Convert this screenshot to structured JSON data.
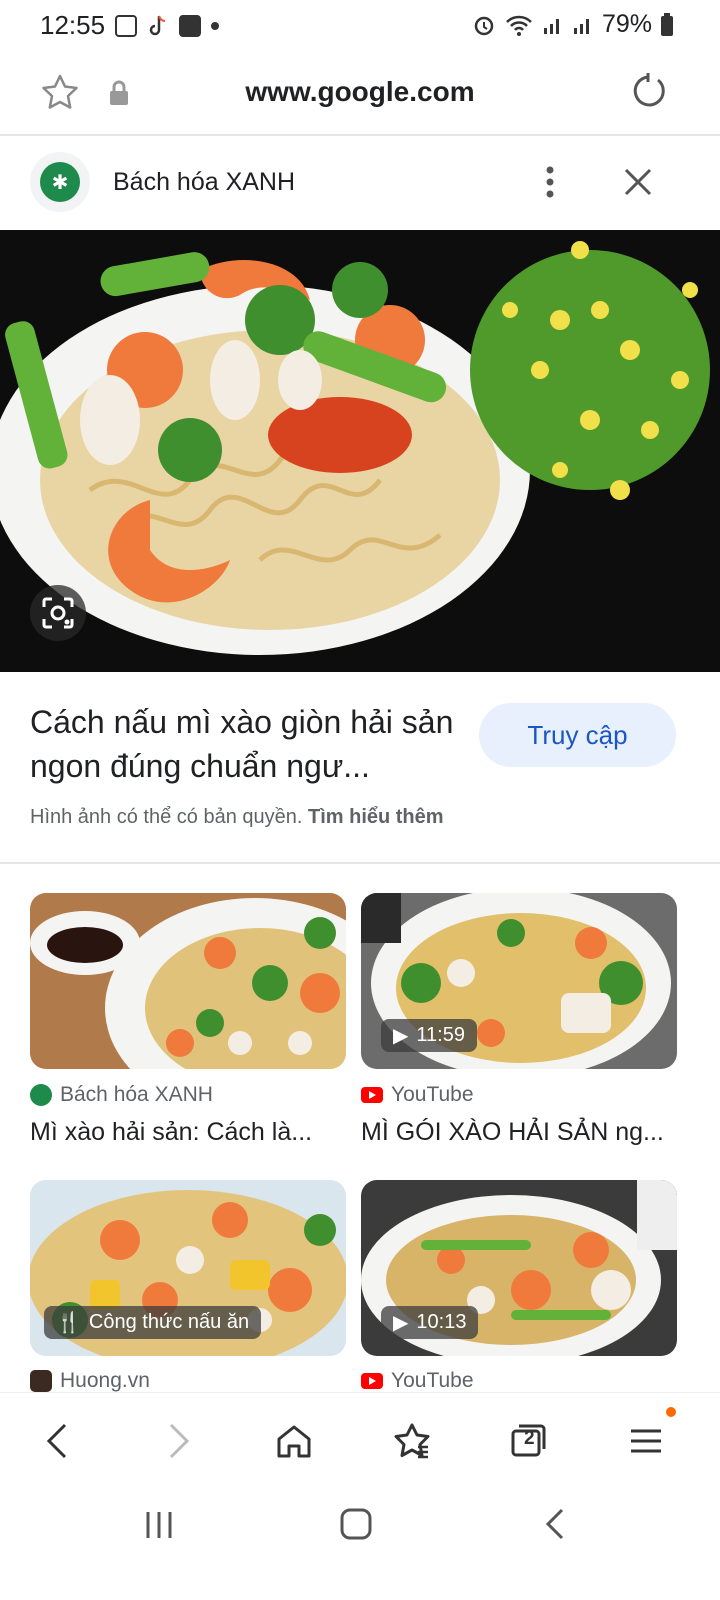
{
  "status": {
    "time": "12:55",
    "battery": "79%"
  },
  "browser": {
    "url": "www.google.com"
  },
  "site": {
    "name": "Bách hóa XANH"
  },
  "result": {
    "title": "Cách nấu mì xào giòn hải sản ngon đúng chuẩn ngư...",
    "visit_label": "Truy cập",
    "copyright_text": "Hình ảnh có thể có bản quyền.",
    "learn_more": "Tìm hiểu thêm"
  },
  "cards": [
    {
      "source": "Bách hóa XANH",
      "title": "Mì xào hải sản: Cách là...",
      "badge": ""
    },
    {
      "source": "YouTube",
      "title": "MÌ GÓI XÀO HẢI SẢN ng...",
      "badge": "11:59"
    },
    {
      "source": "Huong.vn",
      "title": "",
      "badge": "Công thức nấu ăn"
    },
    {
      "source": "YouTube",
      "title": "",
      "badge": "10:13"
    }
  ],
  "bottom_nav": {
    "tabs_count": "2"
  },
  "colors": {
    "accent": "#1a56c4",
    "visit_bg": "#e8f0fe",
    "brand_green": "#1e8a4c",
    "notification_dot": "#ff6a00"
  }
}
